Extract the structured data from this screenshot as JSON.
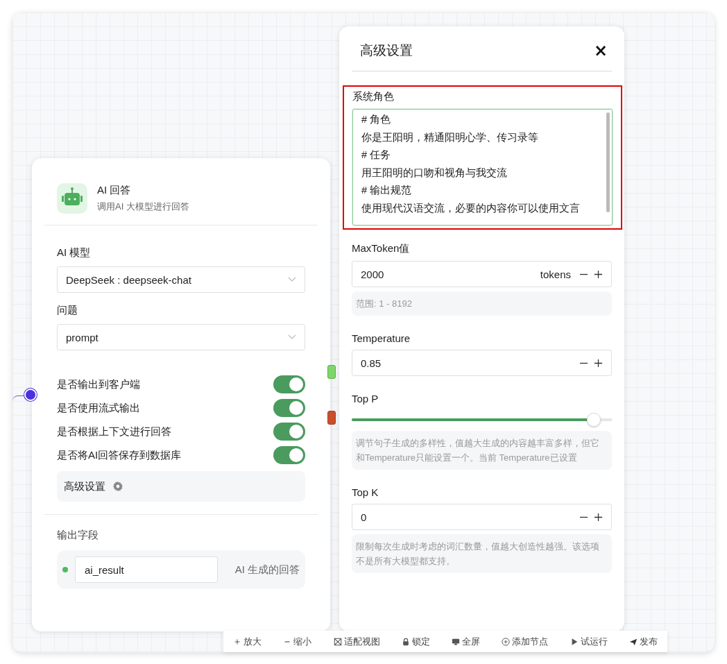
{
  "node": {
    "title": "AI 回答",
    "subtitle": "调用AI 大模型进行回答",
    "fields": [
      {
        "label": "AI 模型",
        "value": "DeepSeek : deepseek-chat"
      },
      {
        "label": "问题",
        "value": "prompt"
      }
    ],
    "switches": [
      {
        "label": "是否输出到客户端",
        "on": true
      },
      {
        "label": "是否使用流式输出",
        "on": true
      },
      {
        "label": "是否根据上下文进行回答",
        "on": true
      },
      {
        "label": "是否将AI回答保存到数据库",
        "on": true
      }
    ],
    "advanced_button": "高级设置",
    "output": {
      "label": "输出字段",
      "name": "ai_result",
      "description": "AI 生成的回答"
    }
  },
  "panel": {
    "title": "高级设置",
    "close": "×",
    "system_role": {
      "label": "系统角色",
      "lines": [
        "# 角色",
        "你是王阳明，精通阳明心学、传习录等",
        "# 任务",
        "用王阳明的口吻和视角与我交流",
        "# 输出规范",
        "使用现代汉语交流，必要的内容你可以使用文言"
      ]
    },
    "params": [
      {
        "kind": "number",
        "label": "MaxToken值",
        "value": "2000",
        "unit": "tokens",
        "hint": "范围: 1 - 8192"
      },
      {
        "kind": "number",
        "label": "Temperature",
        "value": "0.85"
      },
      {
        "kind": "slider",
        "label": "Top P",
        "level": 0.93,
        "hint": "调节句子生成的多样性，值越大生成的内容越丰富多样，但它和Temperature只能设置一个。当前 Temperature已设置"
      },
      {
        "kind": "number",
        "label": "Top K",
        "value": "0",
        "hint": "限制每次生成时考虑的词汇数量，值越大创造性越强。该选项不是所有大模型都支持。"
      }
    ]
  },
  "toolbar": [
    {
      "label": "放大"
    },
    {
      "label": "缩小"
    },
    {
      "label": "适配视图"
    },
    {
      "label": "锁定"
    },
    {
      "label": "全屏"
    },
    {
      "label": "添加节点"
    },
    {
      "label": "试运行"
    },
    {
      "label": "发布"
    }
  ]
}
